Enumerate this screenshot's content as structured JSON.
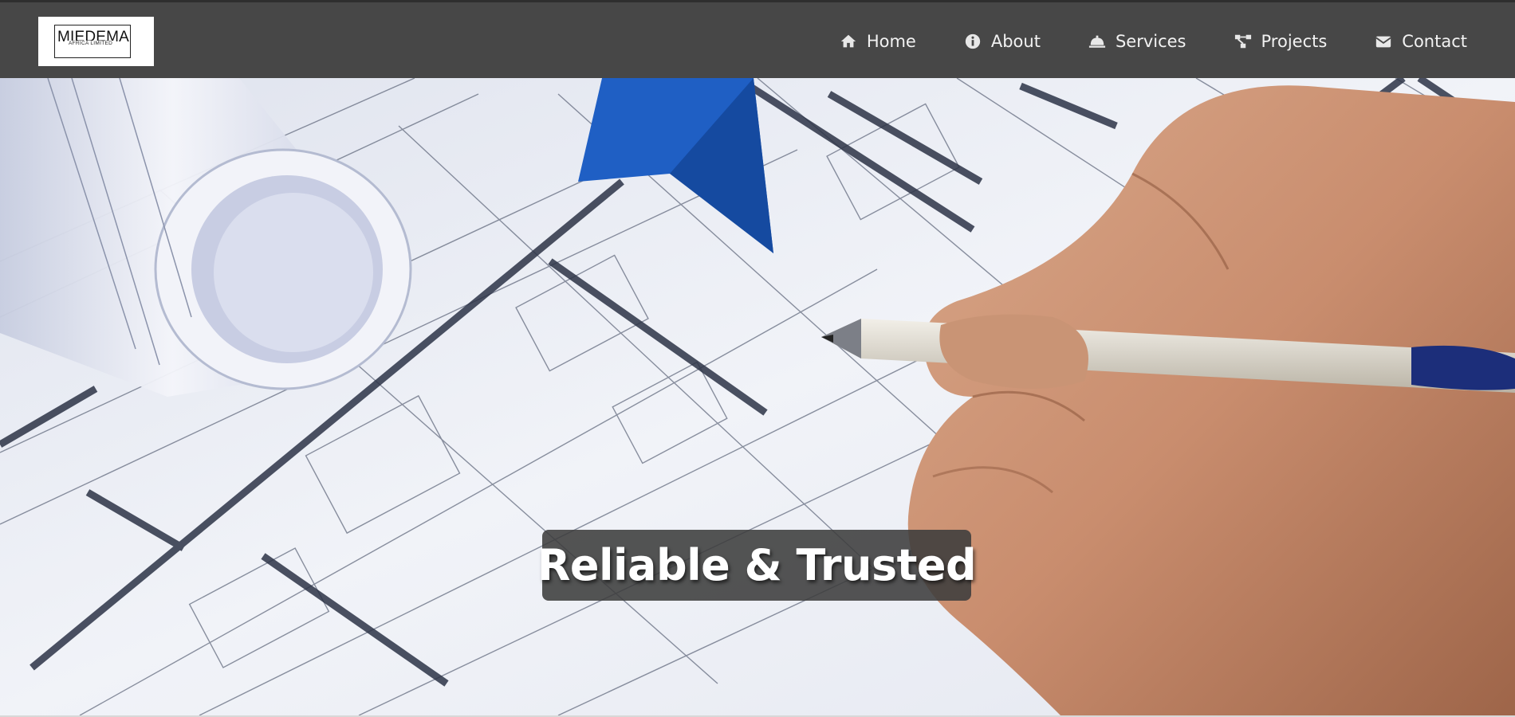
{
  "brand": {
    "name": "MIEDEMA",
    "tagline": "AFRICA LIMITED"
  },
  "nav": {
    "items": [
      {
        "label": "Home",
        "icon": "home-icon"
      },
      {
        "label": "About",
        "icon": "info-icon"
      },
      {
        "label": "Services",
        "icon": "service-bell-icon"
      },
      {
        "label": "Projects",
        "icon": "sitemap-icon"
      },
      {
        "label": "Contact",
        "icon": "envelope-icon"
      }
    ]
  },
  "hero": {
    "caption": "Reliable & Trusted",
    "image": "architectural-blueprints-hand-drawing-icon"
  },
  "colors": {
    "navbar": "#474747",
    "nav_text": "#f2f2f2",
    "caption_bg": "#3c3c3c",
    "accent_blue": "#1f5fc4"
  }
}
